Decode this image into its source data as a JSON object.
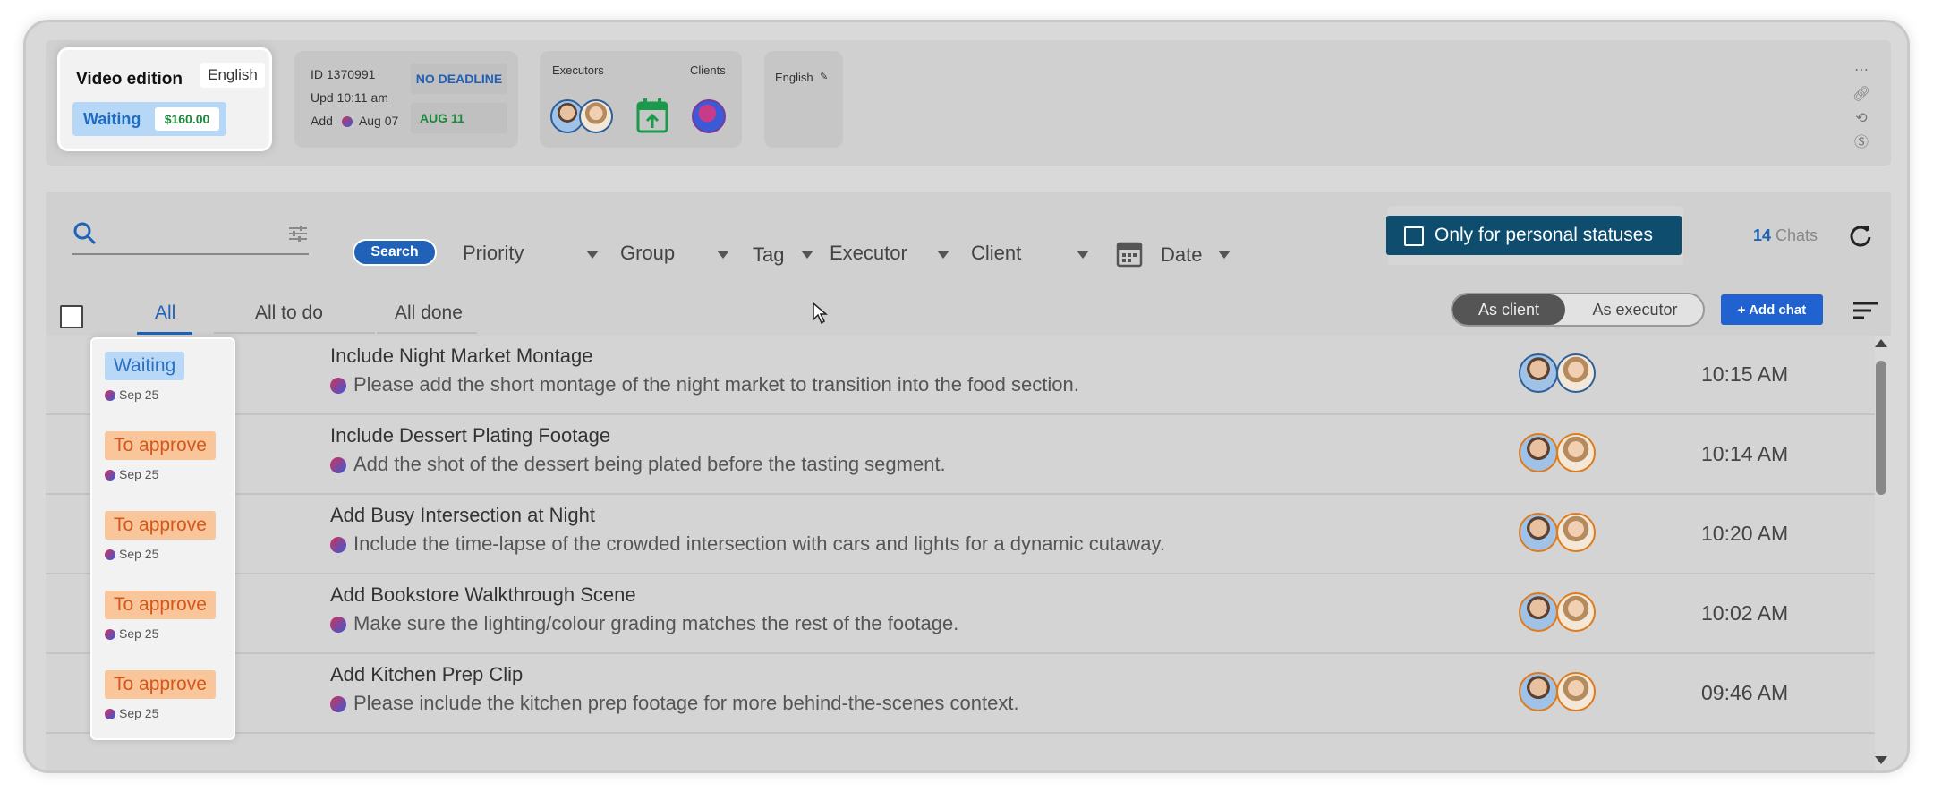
{
  "header": {
    "task_title": "Video edition",
    "language": "English",
    "status": "Waiting",
    "price": "$160.00",
    "id_line": "ID 1370991",
    "upd_line": "Upd 10:11 am",
    "add_label": "Add",
    "add_date": "Aug 07",
    "deadline_label": "NO DEADLINE",
    "deadline_date": "AUG 11",
    "executors_label": "Executors",
    "clients_label": "Clients",
    "lang_card": "English"
  },
  "toolbar": {
    "search_label": "Search",
    "filters": [
      "Priority",
      "Group",
      "Tag",
      "Executor",
      "Client",
      "Date"
    ],
    "personal_label": "Only for personal statuses",
    "chat_count": "14",
    "chats_label": "Chats"
  },
  "tabs": {
    "items": [
      "All",
      "All to do",
      "All done"
    ],
    "active": "All",
    "as_client": "As client",
    "as_executor": "As executor",
    "add_chat": "+ Add chat"
  },
  "rows": [
    {
      "status": "Waiting",
      "date": "Sep 25",
      "title": "Include Night Market Montage",
      "desc": "Please add the short montage of the night market to transition into the food section.",
      "time": "10:15 AM"
    },
    {
      "status": "To approve",
      "date": "Sep 25",
      "title": "Include Dessert Plating Footage",
      "desc": "Add the shot of the dessert being plated before the tasting segment.",
      "time": "10:14 AM"
    },
    {
      "status": "To approve",
      "date": "Sep 25",
      "title": "Add Busy Intersection at Night",
      "desc": "Include the time-lapse of the crowded intersection with cars and lights for a dynamic cutaway.",
      "time": "10:20 AM"
    },
    {
      "status": "To approve",
      "date": "Sep 25",
      "title": "Add Bookstore Walkthrough Scene",
      "desc": "Make sure the lighting/colour grading matches the rest of the footage.",
      "time": "10:02 AM"
    },
    {
      "status": "To approve",
      "date": "Sep 25",
      "title": "Add Kitchen Prep Clip",
      "desc": "Please include the kitchen prep footage for more behind-the-scenes context.",
      "time": "09:46 AM"
    }
  ],
  "colors": {
    "accent": "#1f62b8",
    "personal_btn": "#0f4d6e",
    "waiting": "#2b6fc2",
    "approve": "#d4571a"
  }
}
